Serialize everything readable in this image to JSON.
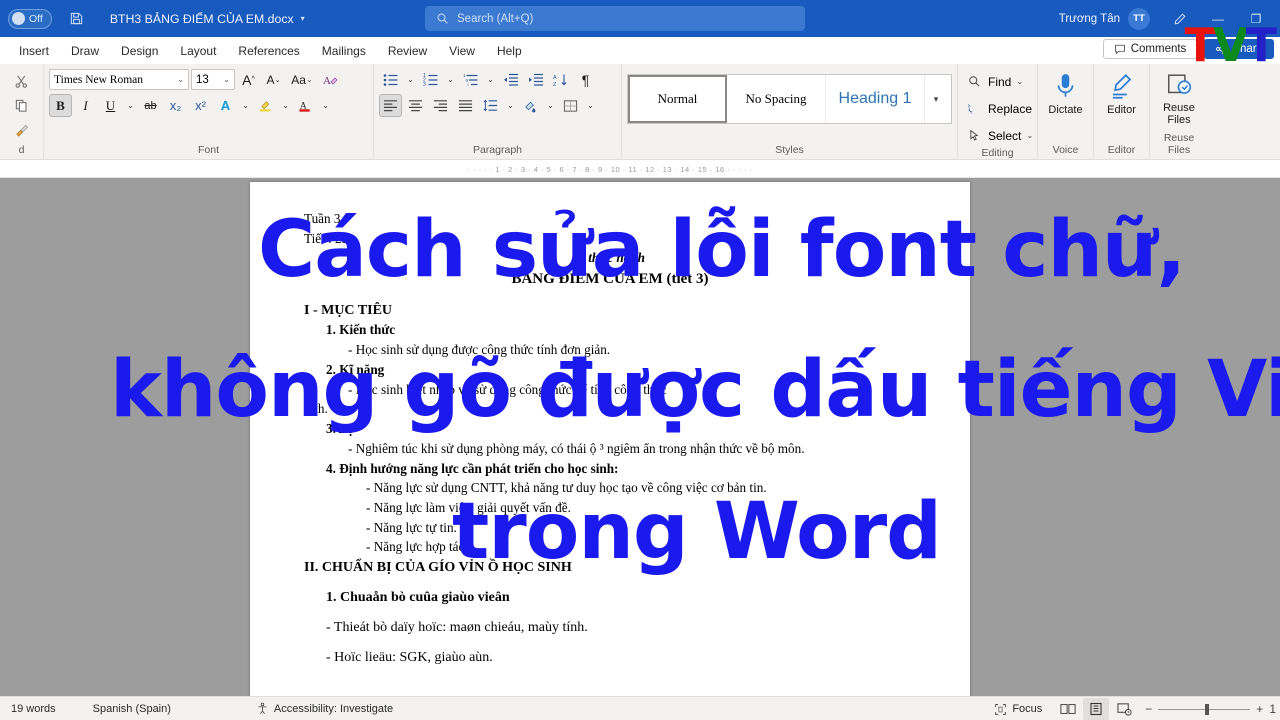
{
  "titlebar": {
    "autosave_label": "Off",
    "save_icon": "save-icon",
    "document_name": "BTH3 BẢNG ĐIỂM CỦA EM.docx",
    "title_caret": "▾",
    "search_placeholder": "Search (Alt+Q)",
    "search_icon": "search-icon",
    "user_name": "Trương Tân",
    "avatar_initials": "TT",
    "pen_icon": "pen-icon",
    "minimize": "—",
    "restore": "❐"
  },
  "tabs": [
    {
      "label": "Insert"
    },
    {
      "label": "Draw"
    },
    {
      "label": "Design"
    },
    {
      "label": "Layout"
    },
    {
      "label": "References"
    },
    {
      "label": "Mailings"
    },
    {
      "label": "Review"
    },
    {
      "label": "View"
    },
    {
      "label": "Help"
    }
  ],
  "tabbar_right": {
    "comments_label": "Comments",
    "comments_icon": "comment-icon",
    "share_label": "Share",
    "share_icon": "share-icon"
  },
  "ribbon": {
    "clipboard": {
      "group_label": "d",
      "cut_icon": "scissors-icon",
      "copy_icon": "copy-icon",
      "format_painter_icon": "paintbrush-icon",
      "dialog_launcher": "⌐"
    },
    "font": {
      "group_label": "Font",
      "font_name": "Times New Roman",
      "font_size": "13",
      "grow_font_icon": "grow-font-icon",
      "shrink_font_icon": "shrink-font-icon",
      "change_case_label": "Aa",
      "clear_formatting_icon": "clear-formatting-icon",
      "bold_label": "B",
      "italic_label": "I",
      "underline_label": "U",
      "strikethrough_label": "ab",
      "subscript_label": "x₂",
      "superscript_label": "x²",
      "text_effects_label": "A",
      "highlight_label": "A",
      "font_color_label": "A",
      "dialog_launcher": "⌐"
    },
    "paragraph": {
      "group_label": "Paragraph",
      "bullets_icon": "bullet-list-icon",
      "numbering_icon": "numbered-list-icon",
      "multilevel_icon": "multilevel-list-icon",
      "decrease_indent_icon": "decrease-indent-icon",
      "increase_indent_icon": "increase-indent-icon",
      "sort_icon": "sort-az-icon",
      "show_marks_icon": "pilcrow-icon",
      "align_left_icon": "align-left-icon",
      "align_center_icon": "align-center-icon",
      "align_right_icon": "align-right-icon",
      "justify_icon": "justify-icon",
      "line_spacing_icon": "line-spacing-icon",
      "shading_icon": "shading-icon",
      "borders_icon": "borders-icon",
      "dialog_launcher": "⌐"
    },
    "styles": {
      "group_label": "Styles",
      "items": [
        {
          "label": "Normal",
          "selected": true
        },
        {
          "label": "No Spacing",
          "selected": false
        },
        {
          "label": "Heading 1",
          "selected": false
        }
      ],
      "more_caret": "▾",
      "dialog_launcher": "⌐"
    },
    "editing": {
      "group_label": "Editing",
      "find_label": "Find",
      "find_icon": "search-icon",
      "replace_label": "Replace",
      "replace_icon": "replace-icon",
      "select_label": "Select",
      "select_icon": "cursor-icon"
    },
    "voice": {
      "group_label": "Voice",
      "dictate_label": "Dictate",
      "dictate_icon": "microphone-icon"
    },
    "editor_group": {
      "group_label": "Editor",
      "editor_label": "Editor",
      "editor_icon": "editor-pen-icon"
    },
    "reuse": {
      "group_label": "Reuse Files",
      "reuse_label": "Reuse Files",
      "reuse_icon": "reuse-files-icon"
    }
  },
  "ruler": {
    "marks": "·  ·  ·  ·  ·  1  ·  2  ·  3  ·  4  ·  5  ·  6  ·  7  ·  8  ·  9  · 10 · 11 · 12 · 13 · 14 · 15 · 16 ·  ·  ·  ·  ·"
  },
  "document": {
    "lines": [
      {
        "text": "Tuần 3",
        "style": "plain"
      },
      {
        "text": "Tiết : 25",
        "style": "plain"
      },
      {
        "text": "... thực hành",
        "style": "center-bold-italic"
      },
      {
        "text": "BẢNG ĐIỂM CỦA EM (tiết 3)",
        "style": "center-bold"
      },
      {
        "text": "",
        "style": "gap"
      },
      {
        "text": "I - MỤC TIÊU",
        "style": "bold"
      },
      {
        "text": "1. Kiến thức",
        "style": "bold-ind1"
      },
      {
        "text": "- Học sinh sử dụng được công thức tính đơn giản.",
        "style": "ind2"
      },
      {
        "text": "2. Kĩ năng",
        "style": "bold-ind1"
      },
      {
        "text": "- Học sinh biết nhập và sử dụng công thức để tính công thức",
        "style": "ind2"
      },
      {
        "text": "tính.",
        "style": "plain"
      },
      {
        "text": "3. Thái ộ",
        "style": "bold-ind1-box"
      },
      {
        "text": "- Nghiêm túc khi sử dụng phòng máy, có thái ộ ³ ngiêm ẩn trong nhận thức về bộ môn.",
        "style": "ind2"
      },
      {
        "text": "4. Định hướng năng lực cần phát triển cho học sinh:",
        "style": "bold-ind1"
      },
      {
        "text": "- Năng lực sử dụng CNTT, khả năng tư duy học tạo về công việc cơ bản tin.",
        "style": "ind3"
      },
      {
        "text": "- Năng lực làm việc, giải quyết vấn đề.",
        "style": "ind3"
      },
      {
        "text": "- Năng lực tự tin.",
        "style": "ind3"
      },
      {
        "text": "- Năng lực hợp tác.",
        "style": "ind3"
      },
      {
        "text": "II. CHUẨN BỊ CỦA GÍO VỈN Ồ HỌC SINH",
        "style": "bold"
      },
      {
        "text": "",
        "style": "gap"
      },
      {
        "text": "1. Chuaån bò cuûa giaùo vieân",
        "style": "bold"
      },
      {
        "text": "",
        "style": "gap"
      },
      {
        "text": "- Thieát bò daïy hoïc: maøn chieáu, maùy tính.",
        "style": "plain"
      },
      {
        "text": "",
        "style": "gap"
      },
      {
        "text": "- Hoïc lieäu: SGK, giaùo aùn.",
        "style": "plain"
      }
    ]
  },
  "statusbar": {
    "word_count": "19 words",
    "language": "Spanish (Spain)",
    "accessibility": "Accessibility: Investigate",
    "accessibility_icon": "accessibility-icon",
    "focus_label": "Focus",
    "focus_icon": "focus-icon",
    "read_mode_icon": "read-mode-icon",
    "print_layout_icon": "print-layout-icon",
    "web_layout_icon": "web-layout-icon",
    "zoom_out": "−",
    "zoom_in": "+",
    "zoom_value": "1"
  },
  "overlay": {
    "line1": "Cách sửa lỗi font chữ,",
    "line2": "không gõ được dấu tiếng Việt",
    "line3": "trong Word",
    "color": "#1a1aee"
  },
  "logo": {
    "letter1": "T",
    "letter2": "V",
    "letter3": "T",
    "color1": "#e8120c",
    "color2": "#0d8a1e",
    "color3": "#2222c8"
  }
}
